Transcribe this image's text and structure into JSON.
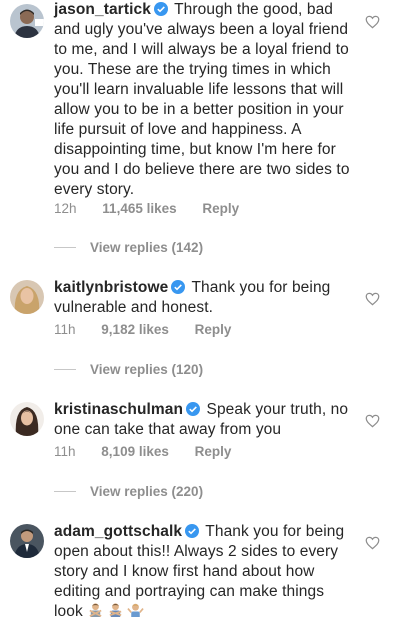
{
  "comments": [
    {
      "username": "jason_tartick",
      "text": "Through the good, bad and ugly you've always been a loyal friend to me, and I will always be a loyal friend to you. These are the trying  times in which you'll learn invaluable life lessons that will allow you to be in a better position in your life pursuit of love and happiness.  A disappointing time, but know I'm here for you and I do believe there are two sides to every story.",
      "time": "12h",
      "likes": "11,465 likes",
      "reply": "Reply",
      "view_replies": "View replies (142)"
    },
    {
      "username": "kaitlynbristowe",
      "text": "Thank you for being vulnerable and honest.",
      "time": "11h",
      "likes": "9,182 likes",
      "reply": "Reply",
      "view_replies": "View replies (120)"
    },
    {
      "username": "kristinaschulman",
      "text": "Speak your truth, no one can take that away from you",
      "time": "11h",
      "likes": "8,109 likes",
      "reply": "Reply",
      "view_replies": "View replies (220)"
    },
    {
      "username": "adam_gottschalk",
      "text": "Thank you for being open about this!! Always 2 sides to every story and I know first hand about how editing and portraying can make things look",
      "emojis": [
        "man-gesturing-no-emoji",
        "men-gesturing-no-emoji",
        "man-shrugging-emoji"
      ]
    }
  ],
  "colors": {
    "text": "#262626",
    "secondary": "#8e8e8e",
    "verified": "#3897f0",
    "divider": "#c7c7c7"
  },
  "icons": {
    "like": "heart-outline-icon",
    "verified": "verified-badge-icon"
  }
}
